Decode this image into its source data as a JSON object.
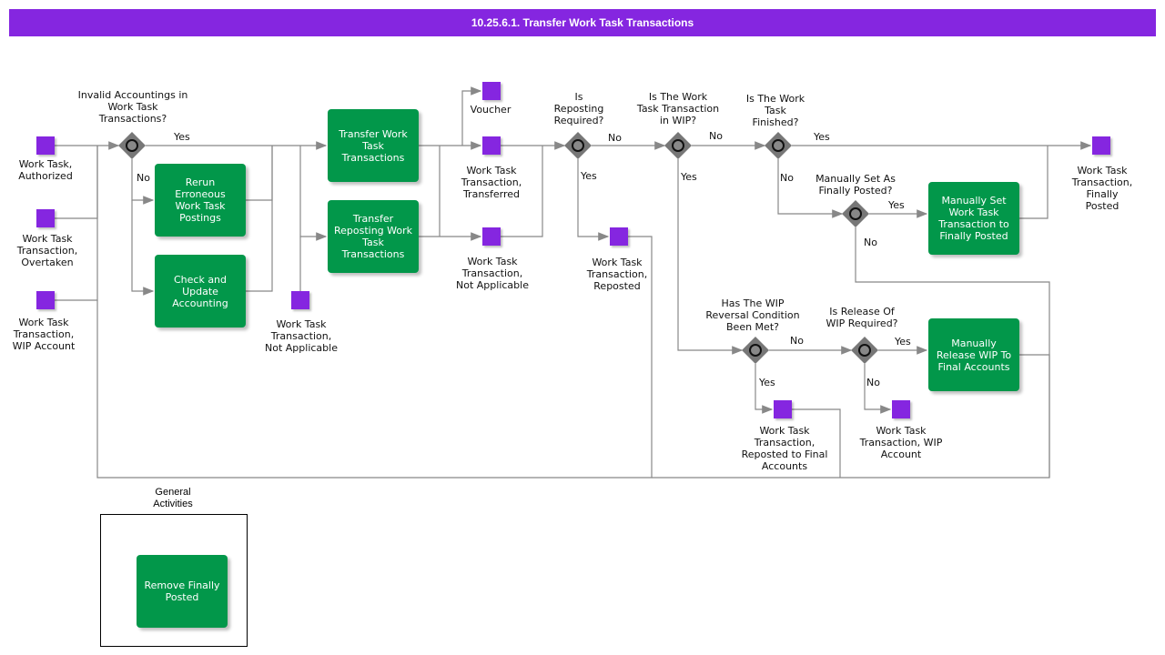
{
  "title": "10.25.6.1. Transfer Work Task Transactions",
  "colors": {
    "header": "#8526e0",
    "task": "#02974a",
    "object": "#8526e0",
    "gateway": "#777777"
  },
  "objects": {
    "work_task_authorized": "Work Task,\nAuthorized",
    "wtt_overtaken": "Work Task\nTransaction,\nOvertaken",
    "wtt_wip_account_in": "Work Task\nTransaction,\nWIP Account",
    "wtt_not_applicable_in": "Work Task\nTransaction,\nNot Applicable",
    "voucher": "Voucher",
    "wtt_transferred": "Work Task\nTransaction,\nTransferred",
    "wtt_not_applicable_out": "Work Task\nTransaction,\nNot Applicable",
    "wtt_reposted": "Work Task\nTransaction,\nReposted",
    "wtt_finally_posted": "Work Task\nTransaction,\nFinally Posted",
    "wtt_reposted_final": "Work Task\nTransaction,\nReposted to Final\nAccounts",
    "wtt_wip_account_out": "Work Task\nTransaction, WIP\nAccount"
  },
  "tasks": {
    "rerun": "Rerun\nErroneous\nWork Task\nPostings",
    "check_update": "Check and\nUpdate\nAccounting",
    "transfer": "Transfer Work\nTask\nTransactions",
    "transfer_reposting": "Transfer\nReposting Work\nTask\nTransactions",
    "manually_set": "Manually Set\nWork Task\nTransaction to\nFinally Posted",
    "manually_release": "Manually\nRelease WIP To\nFinal Accounts",
    "remove_finally_posted": "Remove Finally\nPosted"
  },
  "gateways": {
    "invalid_accountings": "Invalid Accountings in\nWork Task\nTransactions?",
    "reposting_required": "Is\nReposting\nRequired?",
    "in_wip": "Is The Work\nTask Transaction\nin WIP?",
    "finished": "Is The Work\nTask\nFinished?",
    "manually_set_q": "Manually Set As\nFinally Posted?",
    "wip_reversal": "Has The WIP\nReversal Condition\nBeen Met?",
    "release_wip": "Is Release Of\nWIP Required?"
  },
  "flows": {
    "yes": "Yes",
    "no": "No"
  },
  "group": {
    "label": "General\nActivities"
  }
}
